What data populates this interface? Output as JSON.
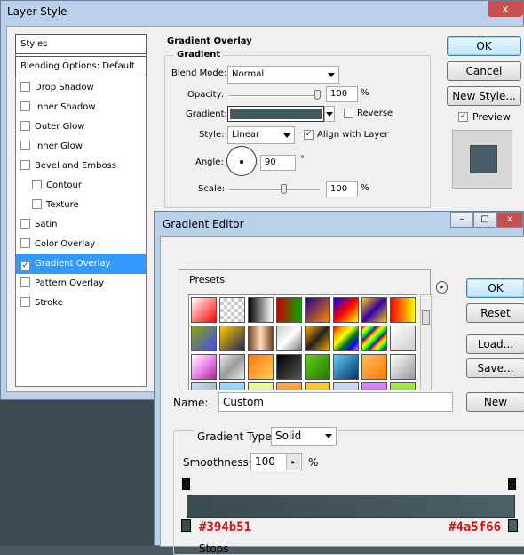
{
  "layer_style": {
    "title": "Layer Style",
    "close": "x",
    "styles_header": "Styles",
    "blending_options": "Blending Options: Default",
    "items": [
      {
        "label": "Drop Shadow",
        "checked": false
      },
      {
        "label": "Inner Shadow",
        "checked": false
      },
      {
        "label": "Outer Glow",
        "checked": false
      },
      {
        "label": "Inner Glow",
        "checked": false
      },
      {
        "label": "Bevel and Emboss",
        "checked": false
      },
      {
        "label": "Contour",
        "checked": false
      },
      {
        "label": "Texture",
        "checked": false
      },
      {
        "label": "Satin",
        "checked": false
      },
      {
        "label": "Color Overlay",
        "checked": false
      },
      {
        "label": "Gradient Overlay",
        "checked": true
      },
      {
        "label": "Pattern Overlay",
        "checked": false
      },
      {
        "label": "Stroke",
        "checked": false
      }
    ],
    "panel": {
      "title": "Gradient Overlay",
      "group": "Gradient",
      "blend_mode_label": "Blend Mode:",
      "blend_mode_value": "Normal",
      "opacity_label": "Opacity:",
      "opacity_value": "100",
      "opacity_unit": "%",
      "gradient_label": "Gradient:",
      "reverse_label": "Reverse",
      "style_label": "Style:",
      "style_value": "Linear",
      "align_label": "Align with Layer",
      "angle_label": "Angle:",
      "angle_value": "90",
      "angle_unit": "°",
      "scale_label": "Scale:",
      "scale_value": "100",
      "scale_unit": "%"
    },
    "buttons": {
      "ok": "OK",
      "cancel": "Cancel",
      "new_style": "New Style...",
      "preview": "Preview"
    },
    "check_glyph": "✓"
  },
  "gradient_editor": {
    "title": "Gradient Editor",
    "presets_label": "Presets",
    "arrow_glyph": "▸",
    "buttons": {
      "ok": "OK",
      "reset": "Reset",
      "load": "Load...",
      "save": "Save...",
      "new": "New"
    },
    "name_label": "Name:",
    "name_value": "Custom",
    "type_label": "Gradient Type:",
    "type_value": "Solid",
    "smoothness_label": "Smoothness:",
    "smoothness_value": "100",
    "smoothness_unit": "%",
    "stops_label": "Stops",
    "color_left": "#394b51",
    "color_right": "#4a5f66",
    "win_min": "–",
    "win_max": "□",
    "win_close": "x"
  }
}
